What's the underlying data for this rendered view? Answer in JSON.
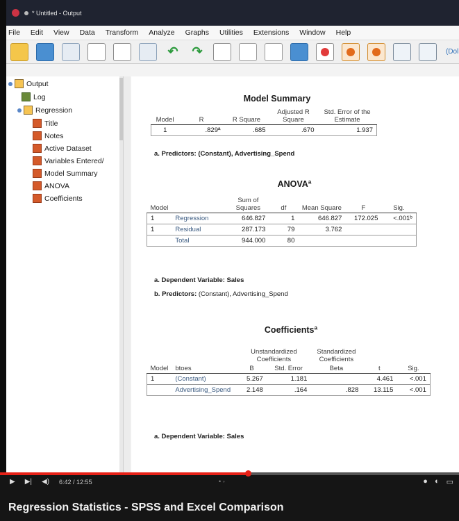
{
  "window": {
    "title": "* Untitled - Output"
  },
  "menu": [
    "File",
    "Edit",
    "View",
    "Data",
    "Transform",
    "Analyze",
    "Graphs",
    "Utilities",
    "Extensions",
    "Window",
    "Help"
  ],
  "toolbar": {
    "link_label": "(Dol"
  },
  "nav": {
    "root": "Output",
    "log": "Log",
    "regression": "Regression",
    "items": [
      "Title",
      "Notes",
      "Active Dataset",
      "Variables Entered/",
      "Model Summary",
      "ANOVA",
      "Coefficients"
    ]
  },
  "model_summary": {
    "title": "Model Summary",
    "headers": [
      "Model",
      "R",
      "R Square",
      "Adjusted R Square",
      "Std. Error of the Estimate"
    ],
    "row": [
      "1",
      ".829ª",
      ".685",
      ".670",
      "1.937"
    ],
    "footnote": "a. Predictors: (Constant), Advertising_Spend"
  },
  "anova": {
    "title": "ANOVAª",
    "headers": [
      "Model",
      "",
      "Sum of Squares",
      "df",
      "Mean Square",
      "F",
      "Sig."
    ],
    "rows": [
      [
        "1",
        "Regression",
        "646.827",
        "1",
        "646.827",
        "172.025",
        "<.001ᵇ"
      ],
      [
        "1",
        "Residual",
        "287.173",
        "79",
        "3.762",
        "",
        ""
      ],
      [
        "",
        "Total",
        "944.000",
        "80",
        "",
        "",
        ""
      ]
    ],
    "footnote_a": "a. Dependent Variable: Sales",
    "footnote_b_label": "b. Predictors:",
    "footnote_b_rest": "(Constant), Advertising_Spend"
  },
  "coefficients": {
    "title": "Coefficientsª",
    "group_unstd": "Unstandardized Coefficients",
    "group_std": "Standardized Coefficients",
    "headers": [
      "Model",
      "btoes",
      "B",
      "Std. Error",
      "Beta",
      "t",
      "Sig."
    ],
    "rows": [
      [
        "1",
        "(Constant)",
        "5.267",
        "1.181",
        "",
        "4.461",
        "<.001"
      ],
      [
        "",
        "Advertising_Spend",
        "2.148",
        ".164",
        ".828",
        "13.115",
        "<.001"
      ]
    ],
    "footnote": "a. Dependent Variable: Sales"
  },
  "video": {
    "time": "6:42 / 12:55",
    "title": "Regression Statistics - SPSS and Excel Comparison",
    "progress_fraction": 0.54
  }
}
